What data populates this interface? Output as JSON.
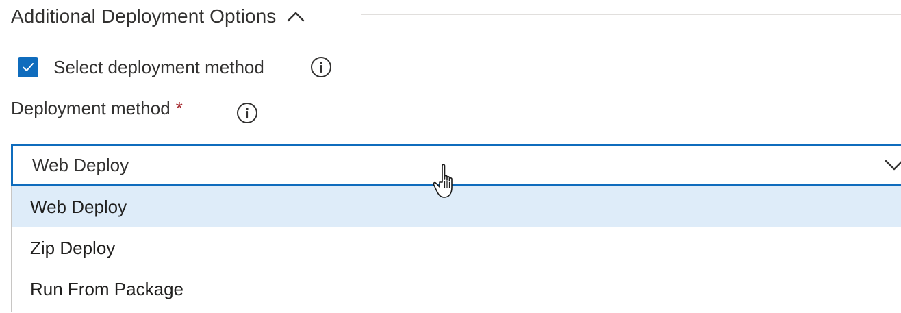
{
  "section": {
    "title": "Additional Deployment Options",
    "expanded": true,
    "toggle_icon": "chevron-up-icon"
  },
  "select_method": {
    "label": "Select deployment method",
    "checked": true,
    "info_icon": "info-icon"
  },
  "deployment_method": {
    "label": "Deployment method",
    "required_marker": "*",
    "info_icon": "info-icon",
    "selected_value": "Web Deploy",
    "dropdown_icon": "chevron-down-icon",
    "options": [
      {
        "label": "Web Deploy",
        "selected": true
      },
      {
        "label": "Zip Deploy",
        "selected": false
      },
      {
        "label": "Run From Package",
        "selected": false
      }
    ]
  },
  "cursor": "hand-pointer-cursor",
  "colors": {
    "accent": "#0f6cbd",
    "selected_option_bg": "#deecf9",
    "required": "#a4262c",
    "text": "#323130"
  }
}
